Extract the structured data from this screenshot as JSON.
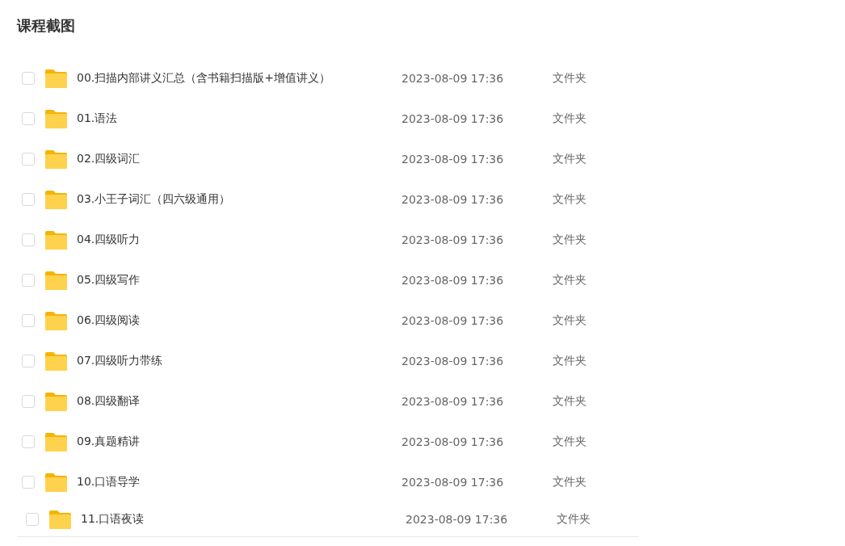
{
  "title": "课程截图",
  "rows": [
    {
      "name": "00.扫描内部讲义汇总（含书籍扫描版+增值讲义）",
      "date": "2023-08-09 17:36",
      "type": "文件夹",
      "checked": false
    },
    {
      "name": "01.语法",
      "date": "2023-08-09 17:36",
      "type": "文件夹",
      "checked": false
    },
    {
      "name": "02.四级词汇",
      "date": "2023-08-09 17:36",
      "type": "文件夹",
      "checked": false
    },
    {
      "name": "03.小王子词汇（四六级通用）",
      "date": "2023-08-09 17:36",
      "type": "文件夹",
      "checked": false
    },
    {
      "name": "04.四级听力",
      "date": "2023-08-09 17:36",
      "type": "文件夹",
      "checked": false
    },
    {
      "name": "05.四级写作",
      "date": "2023-08-09 17:36",
      "type": "文件夹",
      "checked": false
    },
    {
      "name": "06.四级阅读",
      "date": "2023-08-09 17:36",
      "type": "文件夹",
      "checked": false
    },
    {
      "name": "07.四级听力带练",
      "date": "2023-08-09 17:36",
      "type": "文件夹",
      "checked": false
    },
    {
      "name": "08.四级翻译",
      "date": "2023-08-09 17:36",
      "type": "文件夹",
      "checked": false
    },
    {
      "name": "09.真题精讲",
      "date": "2023-08-09 17:36",
      "type": "文件夹",
      "checked": false
    },
    {
      "name": "10.口语导学",
      "date": "2023-08-09 17:36",
      "type": "文件夹",
      "checked": false
    },
    {
      "name": "11.口语夜读",
      "date": "2023-08-09 17:36",
      "type": "文件夹",
      "checked": false
    }
  ]
}
